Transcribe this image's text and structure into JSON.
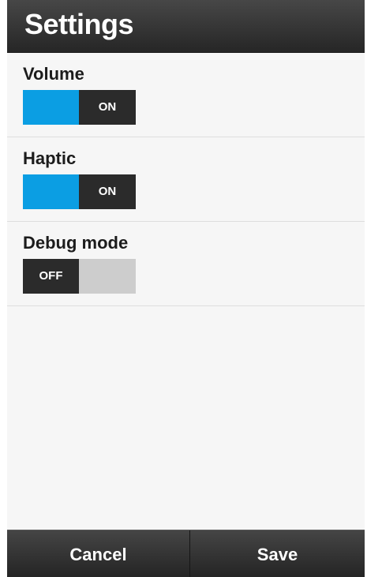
{
  "header": {
    "title": "Settings"
  },
  "settings": [
    {
      "label": "Volume",
      "state": "ON",
      "on": true
    },
    {
      "label": "Haptic",
      "state": "ON",
      "on": true
    },
    {
      "label": "Debug mode",
      "state": "OFF",
      "on": false
    }
  ],
  "colors": {
    "accent": "#0b9ee3",
    "dark_segment": "#2b2b2b",
    "off_segment": "#cdcdcd"
  },
  "footer": {
    "cancel_label": "Cancel",
    "save_label": "Save"
  }
}
